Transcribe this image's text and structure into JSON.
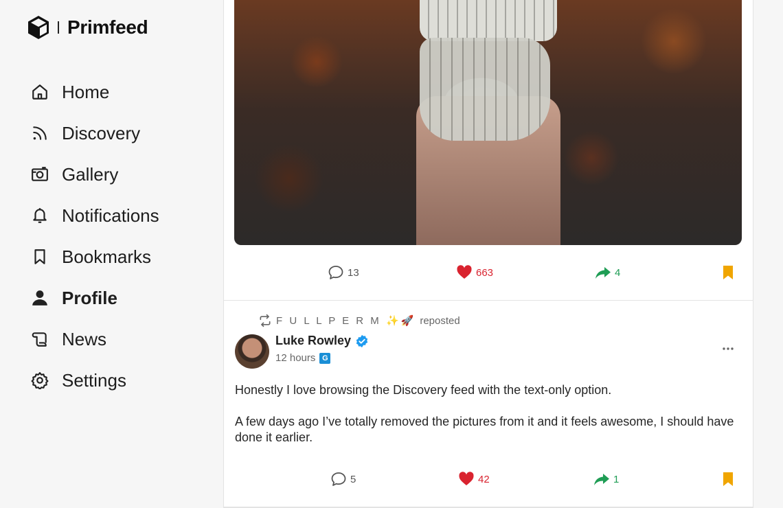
{
  "brand": {
    "name": "Primfeed",
    "logo_icon": "cube-icon"
  },
  "nav": [
    {
      "label": "Home",
      "icon": "home-icon",
      "active": false
    },
    {
      "label": "Discovery",
      "icon": "rss-icon",
      "active": false
    },
    {
      "label": "Gallery",
      "icon": "camera-icon",
      "active": false
    },
    {
      "label": "Notifications",
      "icon": "bell-icon",
      "active": false
    },
    {
      "label": "Bookmarks",
      "icon": "bookmark-icon",
      "active": false
    },
    {
      "label": "Profile",
      "icon": "user-icon",
      "active": true
    },
    {
      "label": "News",
      "icon": "scroll-icon",
      "active": false
    },
    {
      "label": "Settings",
      "icon": "gear-icon",
      "active": false
    }
  ],
  "post1": {
    "comments": "13",
    "likes": "663",
    "shares": "4",
    "bookmarked": true
  },
  "post2": {
    "repost_by": "F U L L P E R M ✨🚀",
    "repost_suffix": "reposted",
    "author": "Luke Rowley",
    "verified": true,
    "time": "12 hours",
    "badge": "G",
    "paragraphs": [
      "Honestly I love browsing the Discovery feed with the text-only option.",
      "A few days ago I’ve totally removed the pictures from it and it feels awesome, I should have done it earlier."
    ],
    "comments": "5",
    "likes": "42",
    "shares": "1",
    "bookmarked": true
  },
  "colors": {
    "like": "#d9232f",
    "share": "#1f9d55",
    "bookmark": "#f0a500",
    "verified": "#1d9bf0"
  }
}
